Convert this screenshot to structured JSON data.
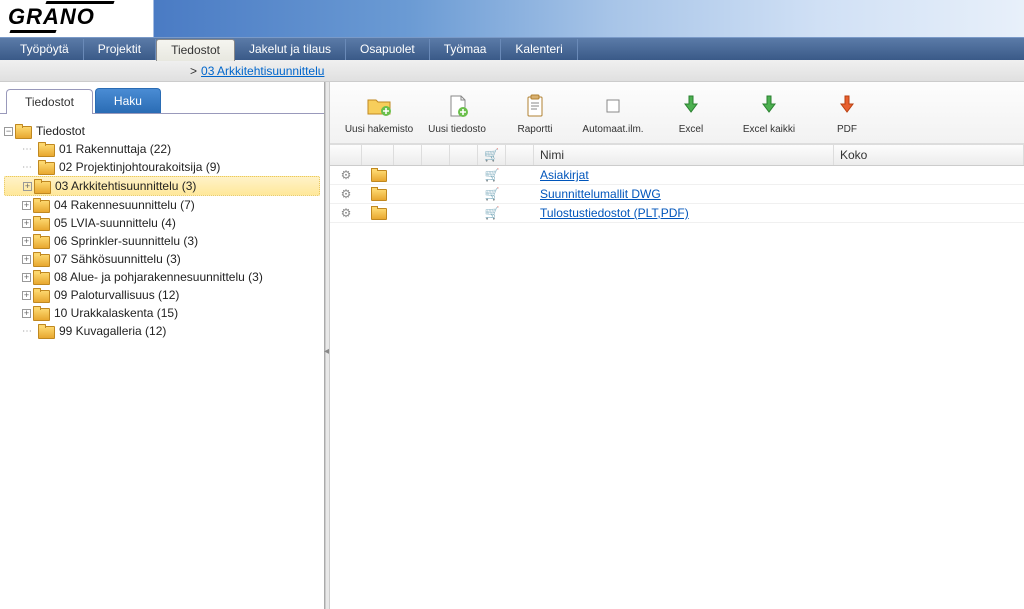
{
  "logo": "GRANO",
  "nav": {
    "items": [
      {
        "label": "Työpöytä",
        "active": false
      },
      {
        "label": "Projektit",
        "active": false
      },
      {
        "label": "Tiedostot",
        "active": true
      },
      {
        "label": "Jakelut ja tilaus",
        "active": false
      },
      {
        "label": "Osapuolet",
        "active": false
      },
      {
        "label": "Työmaa",
        "active": false
      },
      {
        "label": "Kalenteri",
        "active": false
      }
    ]
  },
  "breadcrumb": {
    "prefix": "> ",
    "link": "03 Arkkitehtisuunnittelu"
  },
  "sidebar": {
    "tabs": {
      "files": "Tiedostot",
      "search": "Haku"
    },
    "root": "Tiedostot",
    "items": [
      {
        "label": "01 Rakennuttaja (22)",
        "expandable": false,
        "selected": false
      },
      {
        "label": "02 Projektinjohtourakoitsija (9)",
        "expandable": false,
        "selected": false
      },
      {
        "label": "03 Arkkitehtisuunnittelu (3)",
        "expandable": true,
        "selected": true
      },
      {
        "label": "04 Rakennesuunnittelu (7)",
        "expandable": true,
        "selected": false
      },
      {
        "label": "05 LVIA-suunnittelu (4)",
        "expandable": true,
        "selected": false
      },
      {
        "label": "06 Sprinkler-suunnittelu (3)",
        "expandable": true,
        "selected": false
      },
      {
        "label": "07 Sähkösuunnittelu (3)",
        "expandable": true,
        "selected": false
      },
      {
        "label": "08 Alue- ja pohjarakennesuunnittelu (3)",
        "expandable": true,
        "selected": false
      },
      {
        "label": "09 Paloturvallisuus (12)",
        "expandable": true,
        "selected": false
      },
      {
        "label": "10 Urakkalaskenta (15)",
        "expandable": true,
        "selected": false
      },
      {
        "label": "99 Kuvagalleria (12)",
        "expandable": false,
        "selected": false
      }
    ]
  },
  "toolbar": {
    "new_dir": "Uusi hakemisto",
    "new_file": "Uusi tiedosto",
    "report": "Raportti",
    "auto_notify": "Automaat.ilm.",
    "excel": "Excel",
    "excel_all": "Excel kaikki",
    "pdf": "PDF"
  },
  "grid": {
    "columns": {
      "name": "Nimi",
      "size": "Koko"
    },
    "rows": [
      {
        "name": "Asiakirjat"
      },
      {
        "name": "Suunnittelumallit DWG"
      },
      {
        "name": "Tulostustiedostot (PLT,PDF)"
      }
    ]
  }
}
